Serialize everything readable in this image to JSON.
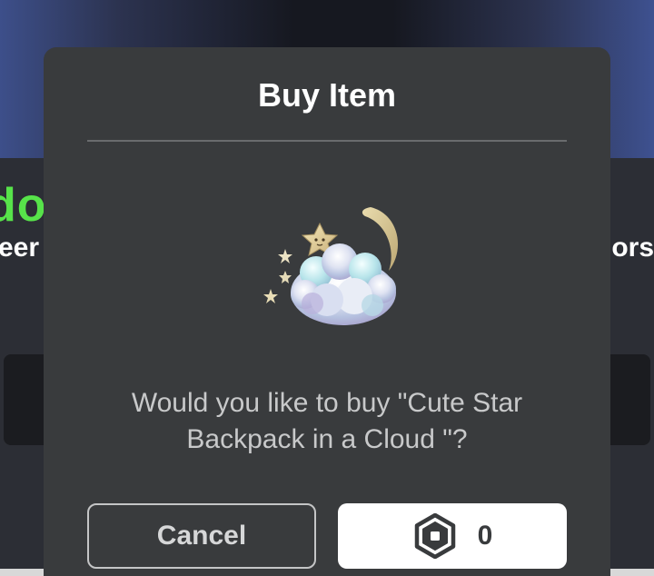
{
  "background": {
    "green_text": "do",
    "left_text": "eer",
    "right_text": "ors"
  },
  "dialog": {
    "title": "Buy Item",
    "prompt": "Would you like to buy \"Cute Star Backpack in a Cloud \"?",
    "item_icon": "cute-star-backpack-cloud-thumbnail",
    "cancel_label": "Cancel",
    "price": "0",
    "currency_icon": "robux-icon"
  },
  "colors": {
    "dialog_bg": "#393b3d",
    "buy_button_bg": "#ffffff",
    "accent_green": "#57e34a"
  }
}
